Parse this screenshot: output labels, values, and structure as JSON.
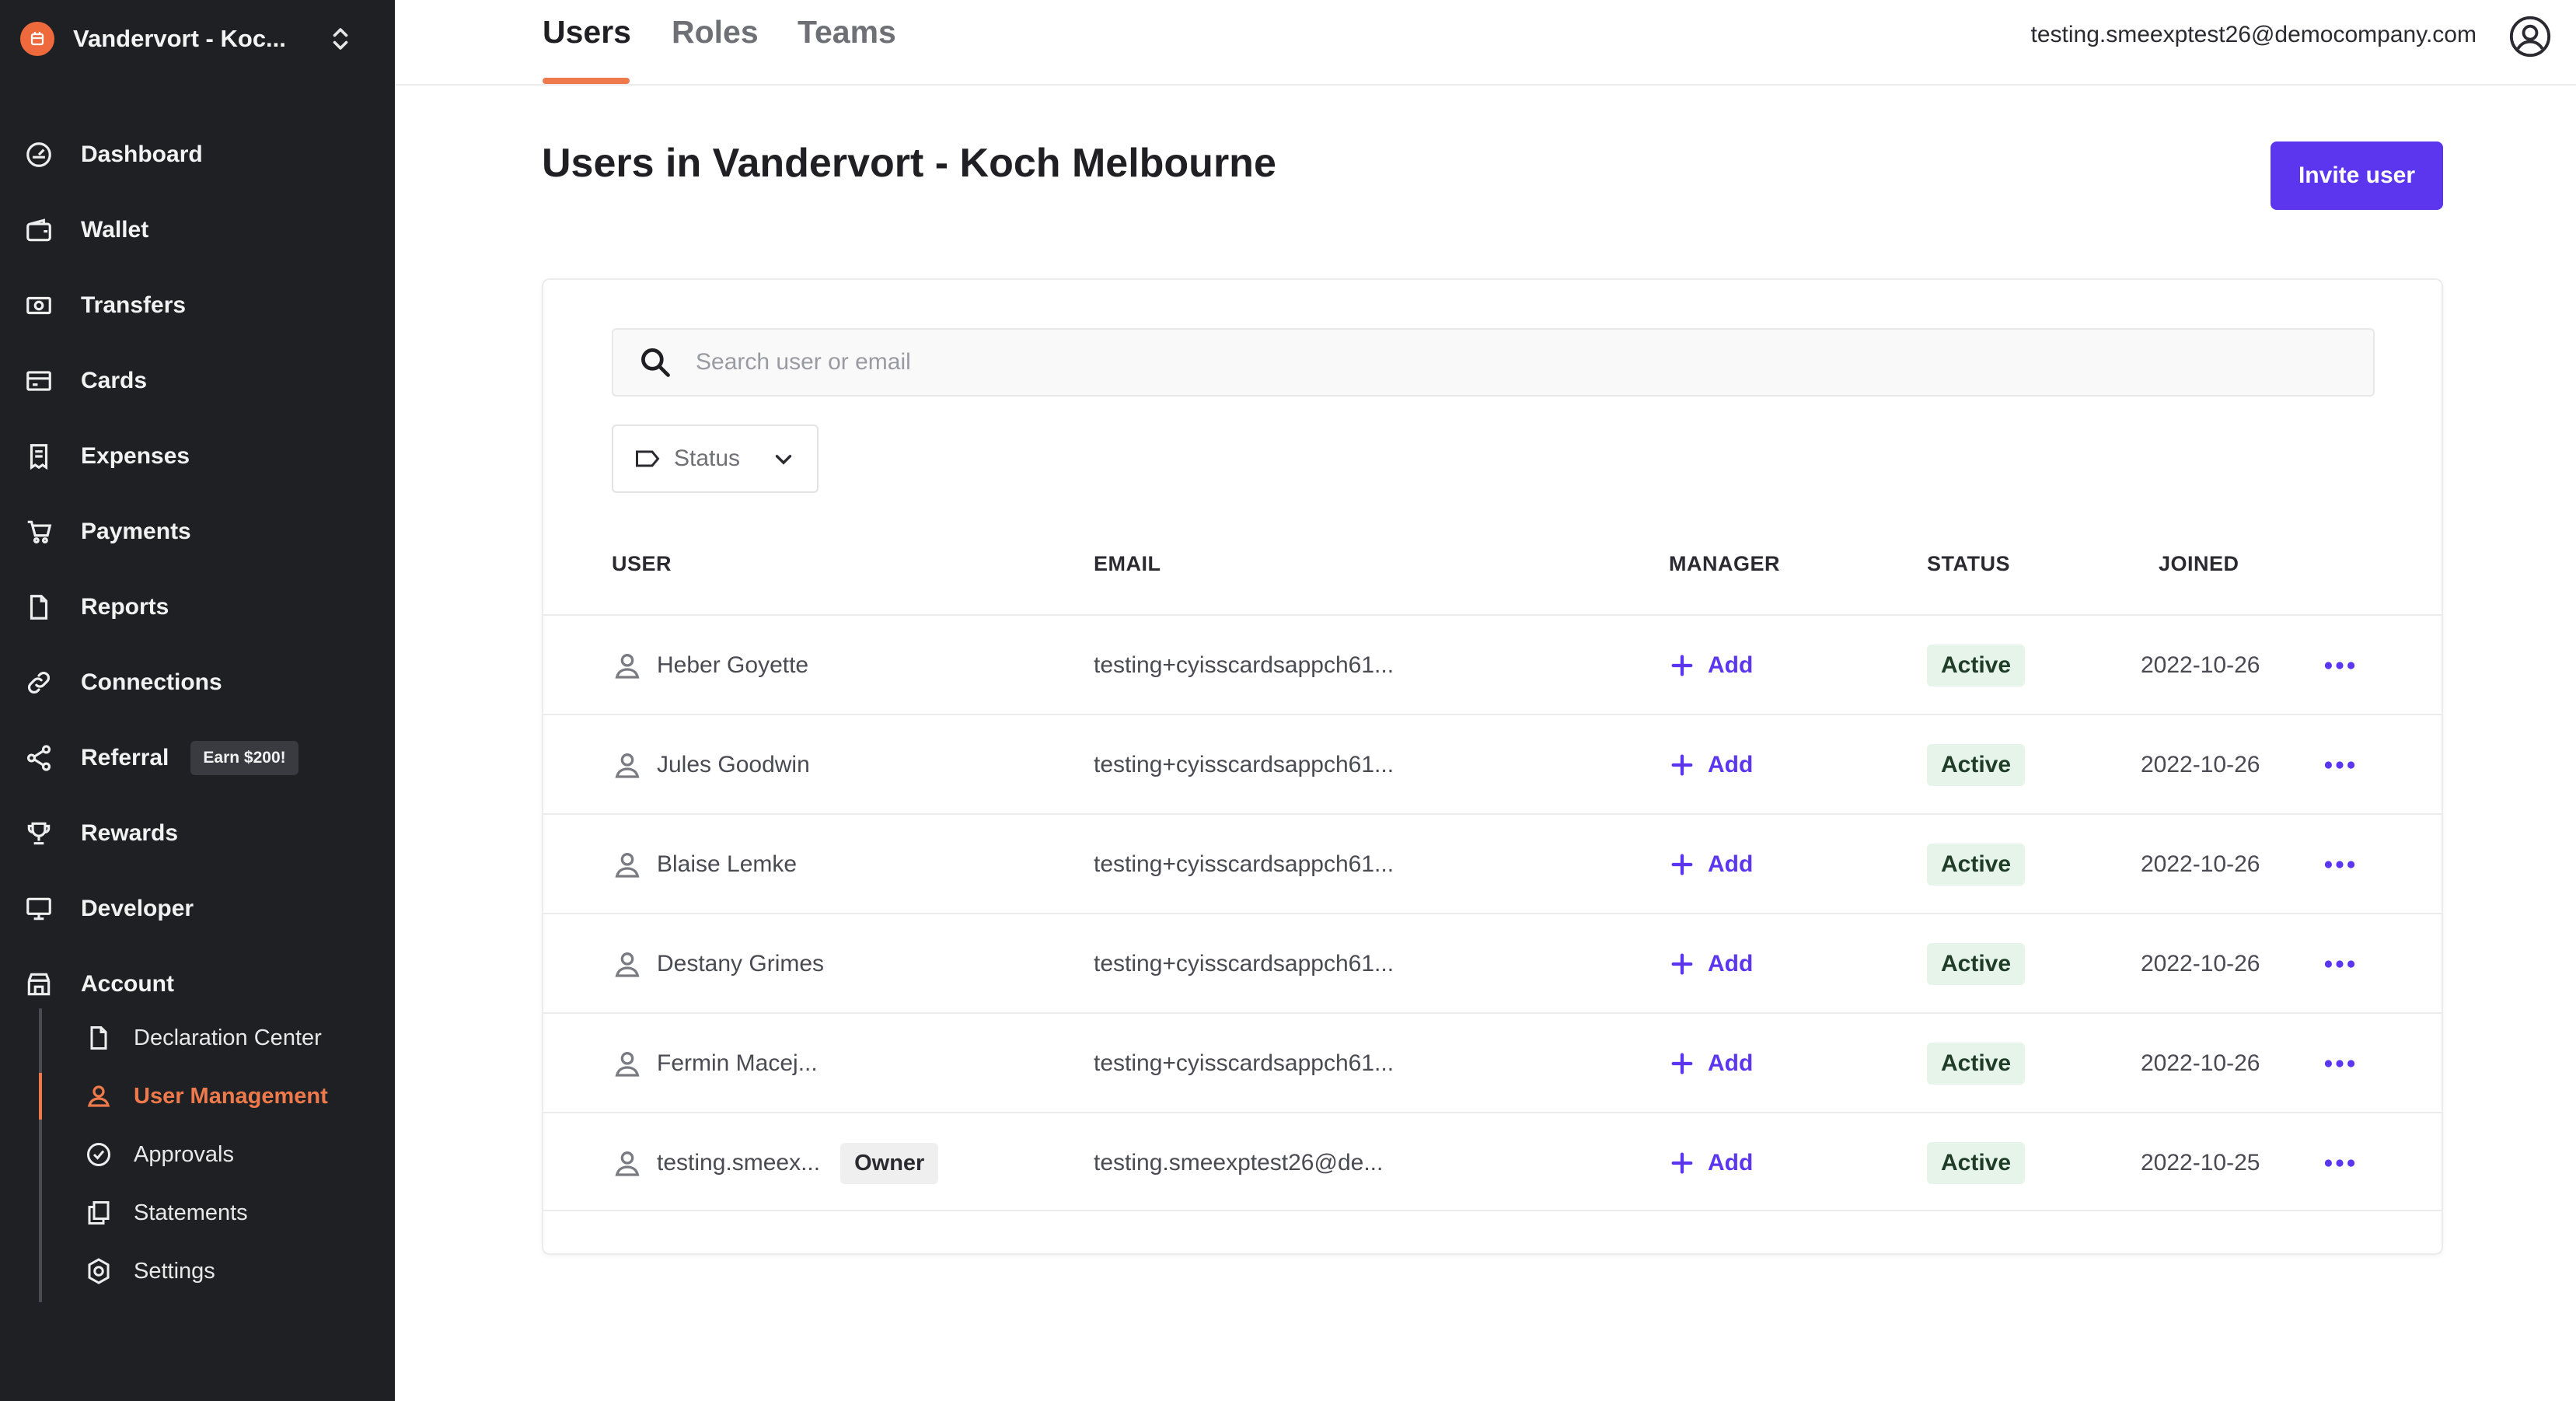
{
  "org": {
    "name": "Vandervort - Koc..."
  },
  "nav": [
    {
      "label": "Dashboard",
      "icon": "dashboard-icon"
    },
    {
      "label": "Wallet",
      "icon": "wallet-icon"
    },
    {
      "label": "Transfers",
      "icon": "transfers-icon"
    },
    {
      "label": "Cards",
      "icon": "cards-icon"
    },
    {
      "label": "Expenses",
      "icon": "expenses-icon"
    },
    {
      "label": "Payments",
      "icon": "cart-icon"
    },
    {
      "label": "Reports",
      "icon": "reports-icon"
    },
    {
      "label": "Connections",
      "icon": "link-icon"
    },
    {
      "label": "Referral",
      "icon": "share-icon",
      "badge": "Earn $200!"
    },
    {
      "label": "Rewards",
      "icon": "trophy-icon"
    },
    {
      "label": "Developer",
      "icon": "monitor-icon"
    },
    {
      "label": "Account",
      "icon": "store-icon"
    }
  ],
  "subnav": [
    {
      "label": "Declaration Center",
      "icon": "document-icon"
    },
    {
      "label": "User Management",
      "icon": "user-icon",
      "active": true
    },
    {
      "label": "Approvals",
      "icon": "check-circle-icon"
    },
    {
      "label": "Statements",
      "icon": "copy-icon"
    },
    {
      "label": "Settings",
      "icon": "gear-icon"
    }
  ],
  "tabs": [
    {
      "label": "Users",
      "active": true
    },
    {
      "label": "Roles"
    },
    {
      "label": "Teams"
    }
  ],
  "header": {
    "email": "testing.smeexptest26@democompany.com"
  },
  "page": {
    "title": "Users in Vandervort - Koch Melbourne",
    "invite_label": "Invite user"
  },
  "search": {
    "placeholder": "Search user or email"
  },
  "filter": {
    "status_label": "Status"
  },
  "table": {
    "columns": {
      "user": "USER",
      "email": "EMAIL",
      "manager": "MANAGER",
      "status": "STATUS",
      "joined": "JOINED"
    },
    "rows": [
      {
        "name": "Heber Goyette",
        "email": "testing+cyisscardsappch61...",
        "manager": "Add",
        "status": "Active",
        "joined": "2022-10-26"
      },
      {
        "name": "Jules Goodwin",
        "email": "testing+cyisscardsappch61...",
        "manager": "Add",
        "status": "Active",
        "joined": "2022-10-26"
      },
      {
        "name": "Blaise Lemke",
        "email": "testing+cyisscardsappch61...",
        "manager": "Add",
        "status": "Active",
        "joined": "2022-10-26"
      },
      {
        "name": "Destany Grimes",
        "email": "testing+cyisscardsappch61...",
        "manager": "Add",
        "status": "Active",
        "joined": "2022-10-26"
      },
      {
        "name": "Fermin Macej...",
        "email": "testing+cyisscardsappch61...",
        "manager": "Add",
        "status": "Active",
        "joined": "2022-10-26"
      },
      {
        "name": "testing.smeex...",
        "badge": "Owner",
        "email": "testing.smeexptest26@de...",
        "manager": "Add",
        "status": "Active",
        "joined": "2022-10-25"
      }
    ]
  },
  "colors": {
    "accent": "#5b36ee",
    "brand": "#ee6a3c",
    "active_nav": "#ee7a4c",
    "sidebar_bg": "#1f2024"
  }
}
